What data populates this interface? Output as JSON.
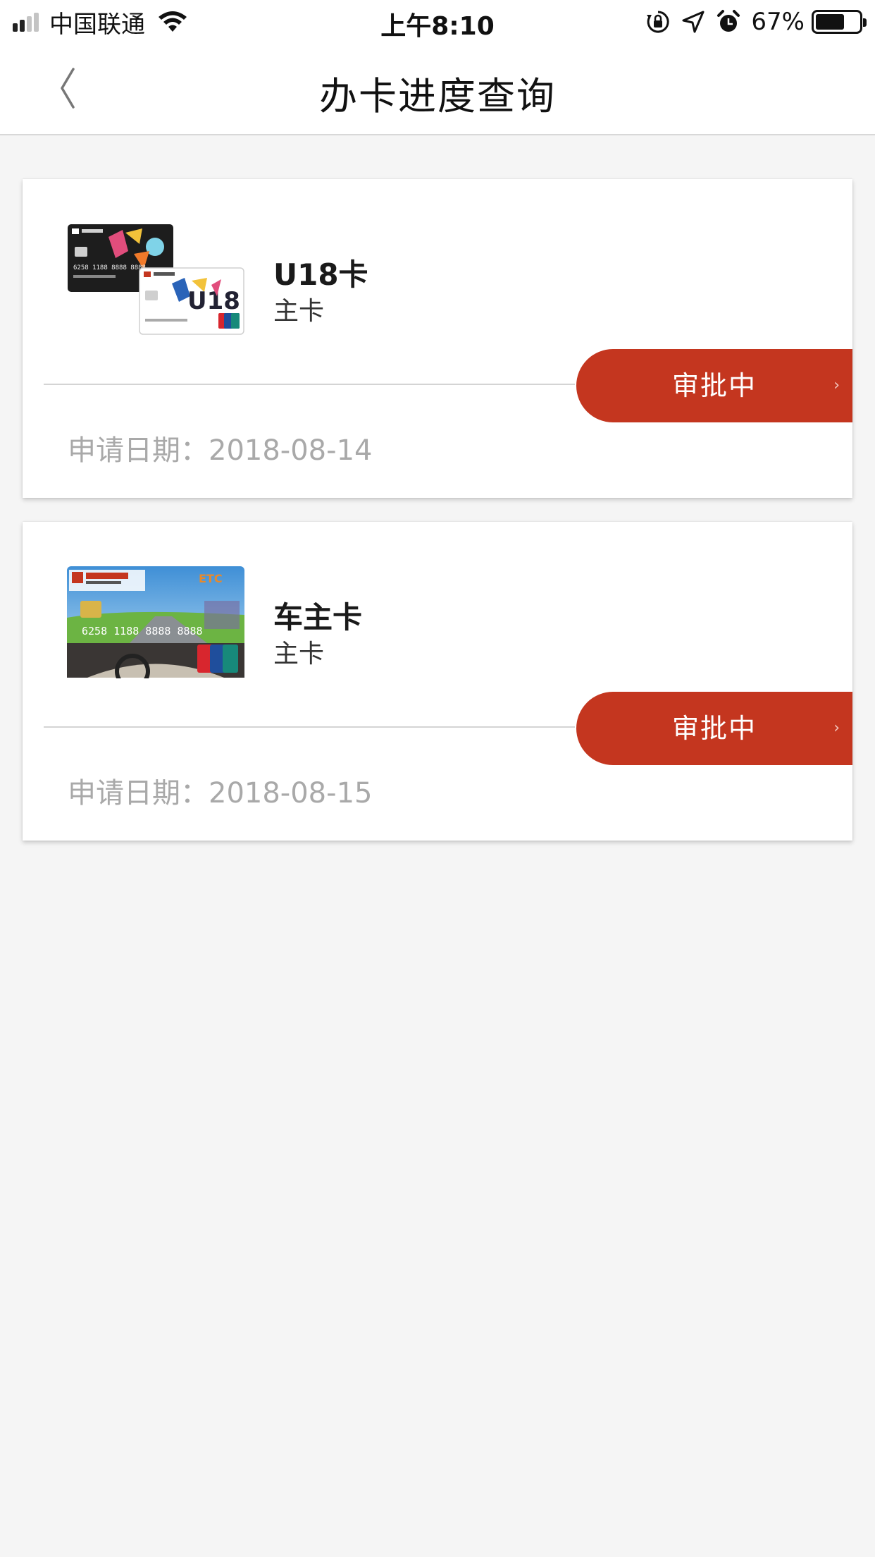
{
  "status_bar": {
    "carrier": "中国联通",
    "time": "上午8:10",
    "battery_percent": "67%",
    "battery_level": 0.67,
    "signal_bars_filled": 2,
    "signal_bars_total": 4,
    "icons": [
      "signal-icon",
      "wifi-icon",
      "rotation-lock-icon",
      "location-icon",
      "alarm-icon",
      "battery-icon"
    ]
  },
  "nav": {
    "back_icon": "chevron-left-icon",
    "title": "办卡进度查询"
  },
  "applications": [
    {
      "card_name": "U18卡",
      "card_type": "主卡",
      "status": "审批中",
      "date_label": "申请日期：",
      "date": "2018-08-14",
      "card_art_text": "U18",
      "card_number_text": "6258 1188 8888 8888"
    },
    {
      "card_name": "车主卡",
      "card_type": "主卡",
      "status": "审批中",
      "date_label": "申请日期：",
      "date": "2018-08-15",
      "card_art_text": "ETC",
      "card_number_text": "6258 1188 8888 8888"
    }
  ],
  "colors": {
    "accent": "#c4361f",
    "background": "#f5f5f5",
    "date_text": "#a9a9a9"
  }
}
